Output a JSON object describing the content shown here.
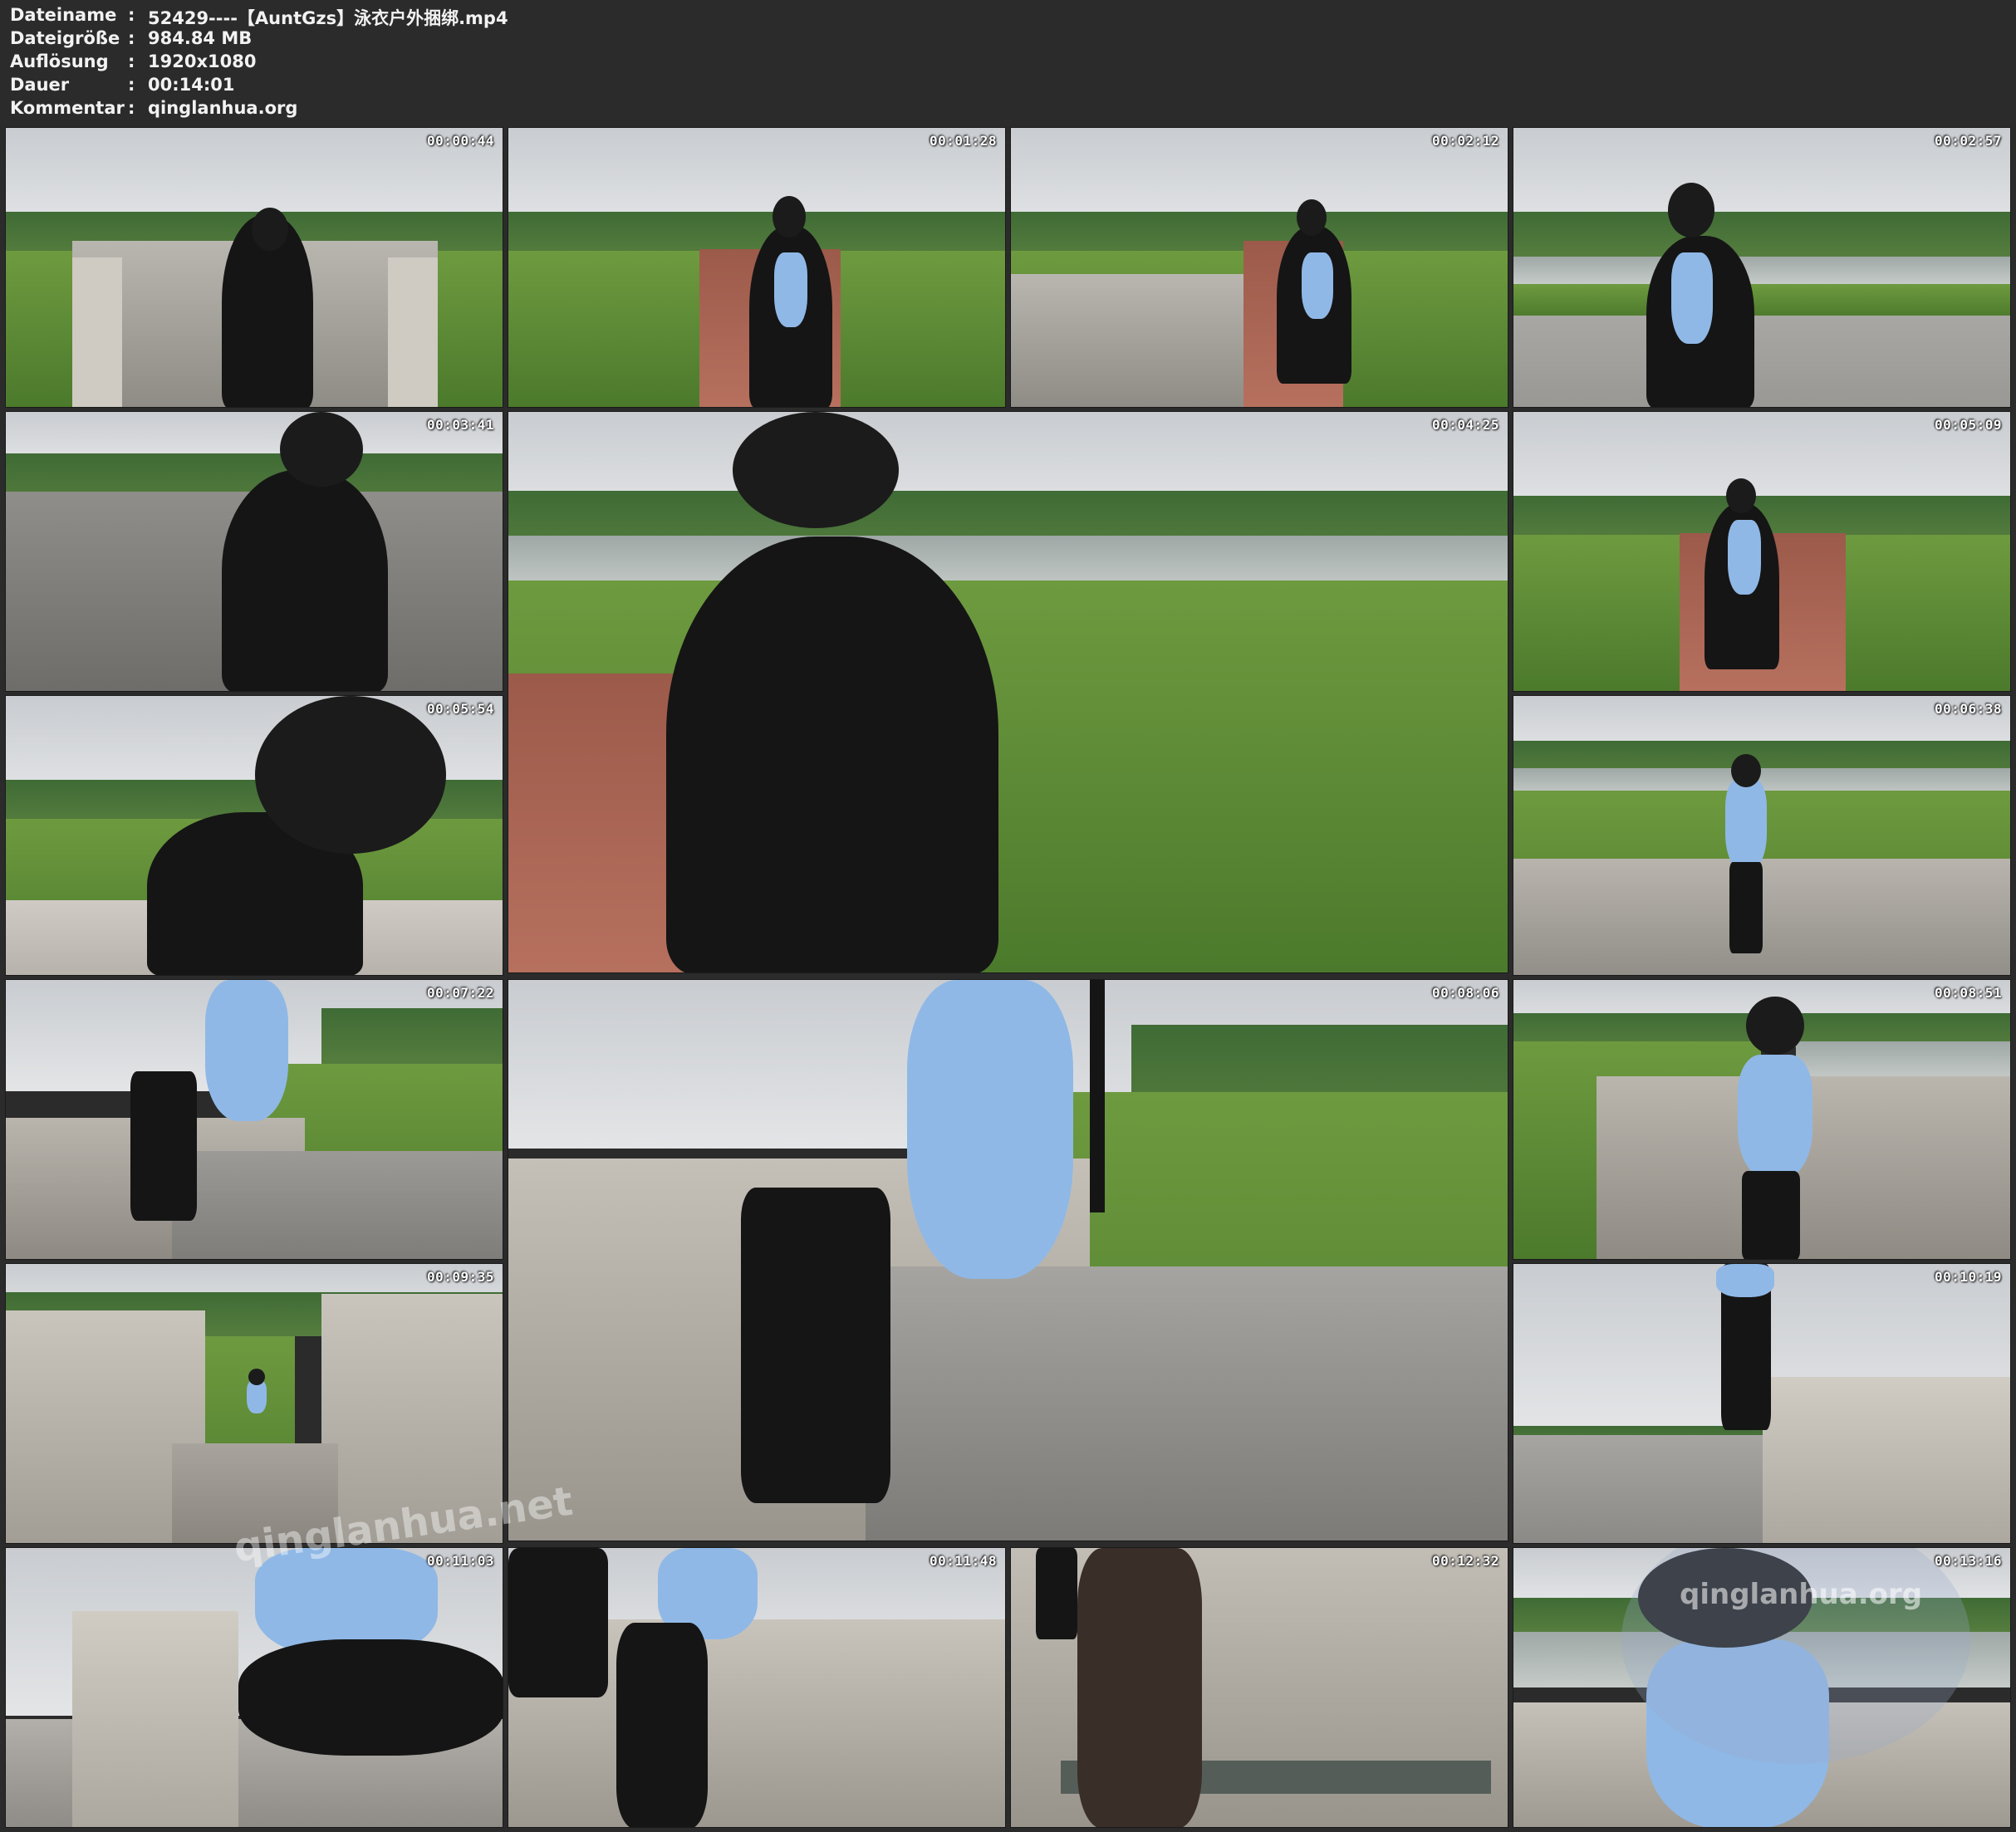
{
  "file_info": {
    "rows": [
      {
        "label": "Dateiname",
        "value": "52429----【AuntGzs】泳衣户外捆绑.mp4"
      },
      {
        "label": "Dateigröße",
        "value": "984.84 MB"
      },
      {
        "label": "Auflösung",
        "value": "1920x1080"
      },
      {
        "label": "Dauer",
        "value": "00:14:01"
      },
      {
        "label": "Kommentar",
        "value": "qinglanhua.org"
      }
    ],
    "separator": ":"
  },
  "thumbnails": [
    {
      "timestamp": "00:00:44"
    },
    {
      "timestamp": "00:01:28"
    },
    {
      "timestamp": "00:02:12"
    },
    {
      "timestamp": "00:02:57"
    },
    {
      "timestamp": "00:03:41"
    },
    {
      "timestamp": "00:04:25"
    },
    {
      "timestamp": "00:05:09"
    },
    {
      "timestamp": "00:05:54"
    },
    {
      "timestamp": "00:06:38"
    },
    {
      "timestamp": "00:07:22"
    },
    {
      "timestamp": "00:08:06"
    },
    {
      "timestamp": "00:08:51"
    },
    {
      "timestamp": "00:09:35"
    },
    {
      "timestamp": "00:10:19"
    },
    {
      "timestamp": "00:11:03"
    },
    {
      "timestamp": "00:11:48"
    },
    {
      "timestamp": "00:12:32"
    },
    {
      "timestamp": "00:13:16"
    }
  ],
  "watermarks": {
    "center": "qinglanhua.net",
    "corner": "qinglanhua.org"
  },
  "colors": {
    "background": "#2b2b2b",
    "text": "#f2f2f2"
  }
}
